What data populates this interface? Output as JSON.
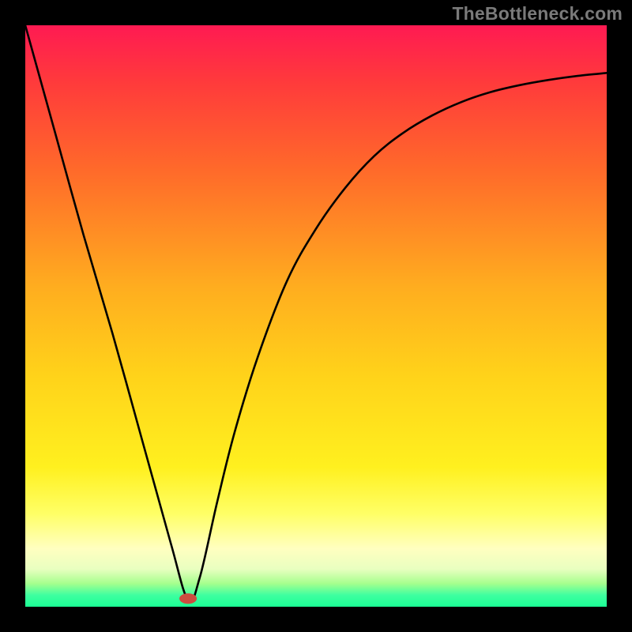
{
  "watermark": "TheBottleneck.com",
  "chart_data": {
    "type": "line",
    "title": "",
    "xlabel": "",
    "ylabel": "",
    "xlim": [
      0,
      100
    ],
    "ylim": [
      0,
      100
    ],
    "background_gradient": {
      "stops": [
        {
          "offset": 0.0,
          "color": "#ff1a52"
        },
        {
          "offset": 0.1,
          "color": "#ff3b3b"
        },
        {
          "offset": 0.25,
          "color": "#ff6a2a"
        },
        {
          "offset": 0.45,
          "color": "#ffad1f"
        },
        {
          "offset": 0.6,
          "color": "#ffd21a"
        },
        {
          "offset": 0.76,
          "color": "#fff01f"
        },
        {
          "offset": 0.84,
          "color": "#ffff66"
        },
        {
          "offset": 0.9,
          "color": "#ffffc0"
        },
        {
          "offset": 0.935,
          "color": "#e9ffc0"
        },
        {
          "offset": 0.96,
          "color": "#a6ff8e"
        },
        {
          "offset": 0.98,
          "color": "#3effa0"
        },
        {
          "offset": 1.0,
          "color": "#1bff95"
        }
      ]
    },
    "marker": {
      "x_pct": 28.0,
      "y_pct": 98.6,
      "rx_pct": 1.5,
      "ry_pct": 0.9,
      "color": "#cc4d40"
    },
    "series": [
      {
        "name": "curve",
        "x": [
          0,
          5,
          10,
          15,
          20,
          25,
          28,
          30,
          33,
          36,
          40,
          45,
          50,
          55,
          60,
          65,
          70,
          75,
          80,
          85,
          90,
          95,
          100
        ],
        "y": [
          100,
          82,
          64,
          47,
          29,
          11,
          1.2,
          5,
          18,
          30,
          43,
          56,
          65,
          72,
          77.5,
          81.5,
          84.5,
          86.8,
          88.5,
          89.7,
          90.6,
          91.3,
          91.8
        ]
      }
    ]
  }
}
